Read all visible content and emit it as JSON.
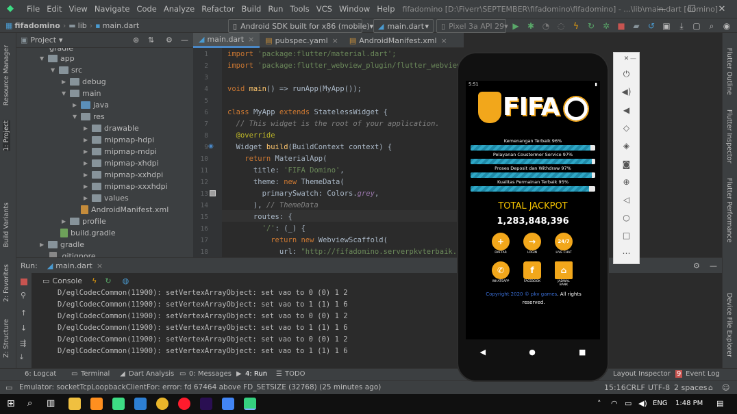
{
  "app": {
    "project": "fifadomino",
    "title": "fifadomino [D:\\Fiverr\\SEPTEMBER\\fifadomino\\fifadomino] - ...\\lib\\main.dart [domino]"
  },
  "menu": [
    "File",
    "Edit",
    "View",
    "Navigate",
    "Code",
    "Analyze",
    "Refactor",
    "Build",
    "Run",
    "Tools",
    "VCS",
    "Window",
    "Help"
  ],
  "nav": {
    "crumbs": [
      "fifadomino",
      "lib",
      "main.dart"
    ],
    "device": "Android SDK built for x86 (mobile)",
    "config": "main.dart",
    "avd": "Pixel 3a API 29"
  },
  "left_tabs": {
    "resource": "Resource Manager",
    "project": "1: Project",
    "build_variants": "Build Variants",
    "favorites": "2: Favorites",
    "structure": "Z: Structure"
  },
  "project_panel": {
    "header": "Project",
    "tree": [
      "gradle",
      "app",
      "src",
      "debug",
      "main",
      "java",
      "res",
      "drawable",
      "mipmap-hdpi",
      "mipmap-mdpi",
      "mipmap-xhdpi",
      "mipmap-xxhdpi",
      "mipmap-xxxhdpi",
      "values",
      "AndroidManifest.xml",
      "profile",
      "build.gradle",
      "gradle",
      ".gitignore"
    ]
  },
  "editor": {
    "tabs": [
      "main.dart",
      "pubspec.yaml",
      "AndroidManifest.xml"
    ],
    "line_numbers": [
      "1",
      "2",
      "3",
      "4",
      "5",
      "6",
      "7",
      "8",
      "9",
      "10",
      "11",
      "12",
      "13",
      "14",
      "15",
      "16",
      "17",
      "18"
    ],
    "imp1_kw": "import ",
    "imp1_str": "'package:flutter/material.dart';",
    "imp2_kw": "import ",
    "imp2_str": "'package:flutter_webview_plugin/flutter_webview",
    "l4_a": "void ",
    "l4_b": "main",
    "l4_c": "() => runApp(MyApp());",
    "l6_a": "class ",
    "l6_b": "MyApp ",
    "l6_c": "extends ",
    "l6_d": "StatelessWidget {",
    "l7": "  // This widget is the root of your application.",
    "l8": "  @override",
    "l9_a": "  Widget ",
    "l9_b": "build",
    "l9_c": "(BuildContext context) {",
    "l10_a": "    return ",
    "l10_b": "MaterialApp(",
    "l11_a": "      title: ",
    "l11_b": "'FIFA Domino'",
    "l11_c": ",",
    "l12_a": "      theme: ",
    "l12_b": "new ",
    "l12_c": "ThemeData(",
    "l13_a": "        primarySwatch: Colors.",
    "l13_b": "grey",
    "l13_c": ",",
    "l14_a": "      ), ",
    "l14_b": "// ThemeData",
    "l15": "      routes: {",
    "l16_a": "        ",
    "l16_b": "'/'",
    "l16_c": ": (_) {",
    "l17_a": "          return ",
    "l17_b": "new ",
    "l17_c": "WebviewScaffold(",
    "l18_a": "            url: ",
    "l18_b": "\"http://fifadomino.serverpkvterbaik.x"
  },
  "run": {
    "label": "Run:",
    "tab": "main.dart",
    "console": "Console",
    "log": [
      "D/eglCodecCommon(11900): setVertexArrayObject: set vao to 0 (0) 1 2",
      "D/eglCodecCommon(11900): setVertexArrayObject: set vao to 1 (1) 1 6",
      "D/eglCodecCommon(11900): setVertexArrayObject: set vao to 0 (0) 1 2",
      "D/eglCodecCommon(11900): setVertexArrayObject: set vao to 1 (1) 1 6",
      "D/eglCodecCommon(11900): setVertexArrayObject: set vao to 0 (0) 1 2",
      "D/eglCodecCommon(11900): setVertexArrayObject: set vao to 1 (1) 1 6"
    ]
  },
  "bottom_tabs": {
    "logcat": "6: Logcat",
    "terminal": "Terminal",
    "dart": "Dart Analysis",
    "messages": "0: Messages",
    "run": "4: Run",
    "todo": "TODO",
    "layout": "Layout Inspector",
    "event": "Event Log"
  },
  "status": {
    "message": "Emulator: socketTcpLoopbackClientFor: error: fd 67464 above FD_SETSIZE (32768) (25 minutes ago)",
    "position": "15:16",
    "crlf": "CRLF",
    "encoding": "UTF-8",
    "indent": "2 spaces"
  },
  "right_tabs": {
    "outline": "Flutter Outline",
    "inspector": "Flutter Inspector",
    "performance": "Flutter Performance",
    "device": "Device File Explorer"
  },
  "phone": {
    "time": "5:51",
    "logo": "FIFA",
    "bars": [
      {
        "label": "Kemenangan Terbaik 96%",
        "value": 96
      },
      {
        "label": "Pelayanan Coustermer Service 97%",
        "value": 97
      },
      {
        "label": "Proses Deposit dan Withdraw 97%",
        "value": 97
      },
      {
        "label": "Kualitas Permainan Terbaik 95%",
        "value": 95
      }
    ],
    "jackpot_title": "TOTAL JACKPOT",
    "jackpot_value": "1,283,848,396",
    "icons": [
      {
        "label": "DAFTAR"
      },
      {
        "label": "LOGIN"
      },
      {
        "label": "LIVE CHAT"
      },
      {
        "label": "WHATSAPP"
      },
      {
        "label": "FACEBOOK"
      },
      {
        "label": "JADWAL BANK"
      }
    ],
    "footer_link": "Copyright 2020 © pkv games",
    "footer_text": ". All rights reserved."
  },
  "taskbar": {
    "time": "1:48 PM",
    "lang": "ENG"
  }
}
